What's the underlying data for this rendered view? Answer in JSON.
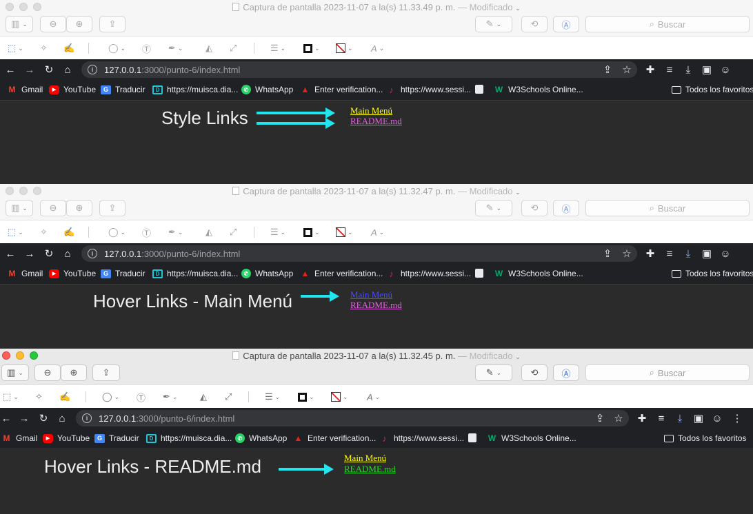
{
  "windows": [
    {
      "title": "Captura de pantalla 2023-11-07 a la(s) 11.33.49 p. m.",
      "modified": "— Modificado",
      "search_placeholder": "Buscar",
      "url_host": "127.0.0.1",
      "url_path": ":3000/punto-6/index.html",
      "label": "Style Links",
      "links": [
        {
          "text": "Main Menú",
          "color": "#ffff00"
        },
        {
          "text": "README.md",
          "color": "#e060e0"
        }
      ]
    },
    {
      "title": "Captura de pantalla 2023-11-07 a la(s) 11.32.47 p. m.",
      "modified": "— Modificado",
      "search_placeholder": "Buscar",
      "url_host": "127.0.0.1",
      "url_path": ":3000/punto-6/index.html",
      "label": "Hover Links - Main Menú",
      "links": [
        {
          "text": "Main Menú",
          "color": "#4a4aff"
        },
        {
          "text": "README.md",
          "color": "#e060e0"
        }
      ]
    },
    {
      "title": "Captura de pantalla 2023-11-07 a la(s) 11.32.45 p. m.",
      "modified": "— Modificado",
      "search_placeholder": "Buscar",
      "url_host": "127.0.0.1",
      "url_path": ":3000/punto-6/index.html",
      "label": "Hover Links - README.md",
      "links": [
        {
          "text": "Main Menú",
          "color": "#ffff00"
        },
        {
          "text": "README.md",
          "color": "#22dd22"
        }
      ]
    }
  ],
  "bookmarks": [
    {
      "label": "Gmail",
      "icon": "gmail-icon"
    },
    {
      "label": "YouTube",
      "icon": "youtube-icon"
    },
    {
      "label": "Traducir",
      "icon": "translate-icon"
    },
    {
      "label": "https://muisca.dia...",
      "icon": "muisca-icon"
    },
    {
      "label": "WhatsApp",
      "icon": "whatsapp-icon"
    },
    {
      "label": "Enter verification...",
      "icon": "adobe-icon"
    },
    {
      "label": "https://www.sessi...",
      "icon": "music-note-icon"
    },
    {
      "label": "",
      "icon": "doc-icon"
    },
    {
      "label": "W3Schools Online...",
      "icon": "w3schools-icon"
    }
  ],
  "all_bookmarks": "Todos los favoritos",
  "colors": {
    "arrow": "#22e6ee",
    "page_bg": "#2b2b2b",
    "chrome_bg": "#202124"
  }
}
